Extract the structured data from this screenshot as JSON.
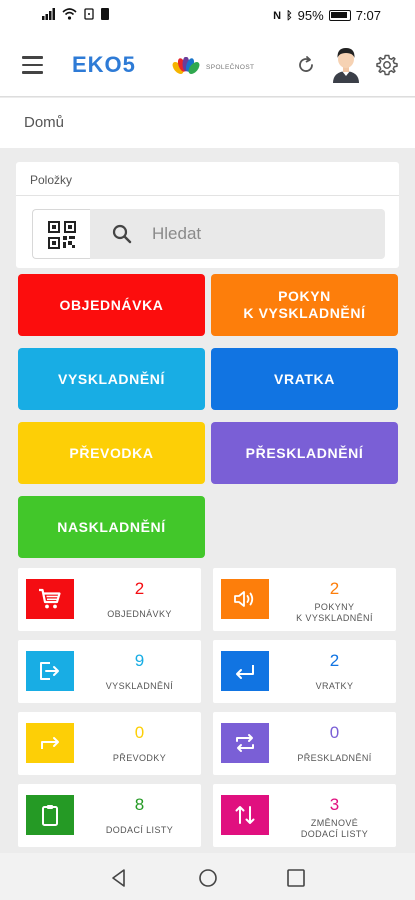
{
  "status_bar": {
    "battery": "95%",
    "time": "7:07"
  },
  "app_bar": {
    "title": "EKO5",
    "company_name": "SPOLEČNOST"
  },
  "breadcrumb": {
    "home": "Domů"
  },
  "items_card": {
    "title": "Položky",
    "search_placeholder": "Hledat"
  },
  "actions": [
    {
      "label": "OBJEDNÁVKA",
      "color": "#fc0d0d"
    },
    {
      "label": "POKYN\nK VYSKLADNĚNÍ",
      "color": "#fd7e0b"
    },
    {
      "label": "VYSKLADNĚNÍ",
      "color": "#18ade4"
    },
    {
      "label": "VRATKA",
      "color": "#1174e2"
    },
    {
      "label": "PŘEVODKA",
      "color": "#fdcf06"
    },
    {
      "label": "PŘESKLADNĚNÍ",
      "color": "#7a5fd6"
    },
    {
      "label": "NASKLADNĚNÍ",
      "color": "#42c72a"
    }
  ],
  "tiles": [
    {
      "count": "2",
      "label": "OBJEDNÁVKY",
      "icon": "cart-icon",
      "color": "#f40d12"
    },
    {
      "count": "2",
      "label": "POKYNY\nK VYSKLADNĚNÍ",
      "icon": "speaker-icon",
      "color": "#fd7e0b"
    },
    {
      "count": "9",
      "label": "VYSKLADNĚNÍ",
      "icon": "logout-icon",
      "color": "#18ade4"
    },
    {
      "count": "2",
      "label": "VRATKY",
      "icon": "return-arrow-icon",
      "color": "#1174e2"
    },
    {
      "count": "0",
      "label": "PŘEVODKY",
      "icon": "forward-arrow-icon",
      "color": "#fdcf06"
    },
    {
      "count": "0",
      "label": "PŘESKLADNĚNÍ",
      "icon": "swap-icon",
      "color": "#7a5fd6"
    },
    {
      "count": "8",
      "label": "DODACÍ LISTY",
      "icon": "clipboard-icon",
      "color": "#259a25"
    },
    {
      "count": "3",
      "label": "ZMĚNOVÉ\nDODACÍ LISTY",
      "icon": "exchange-icon",
      "color": "#e0107f"
    }
  ]
}
